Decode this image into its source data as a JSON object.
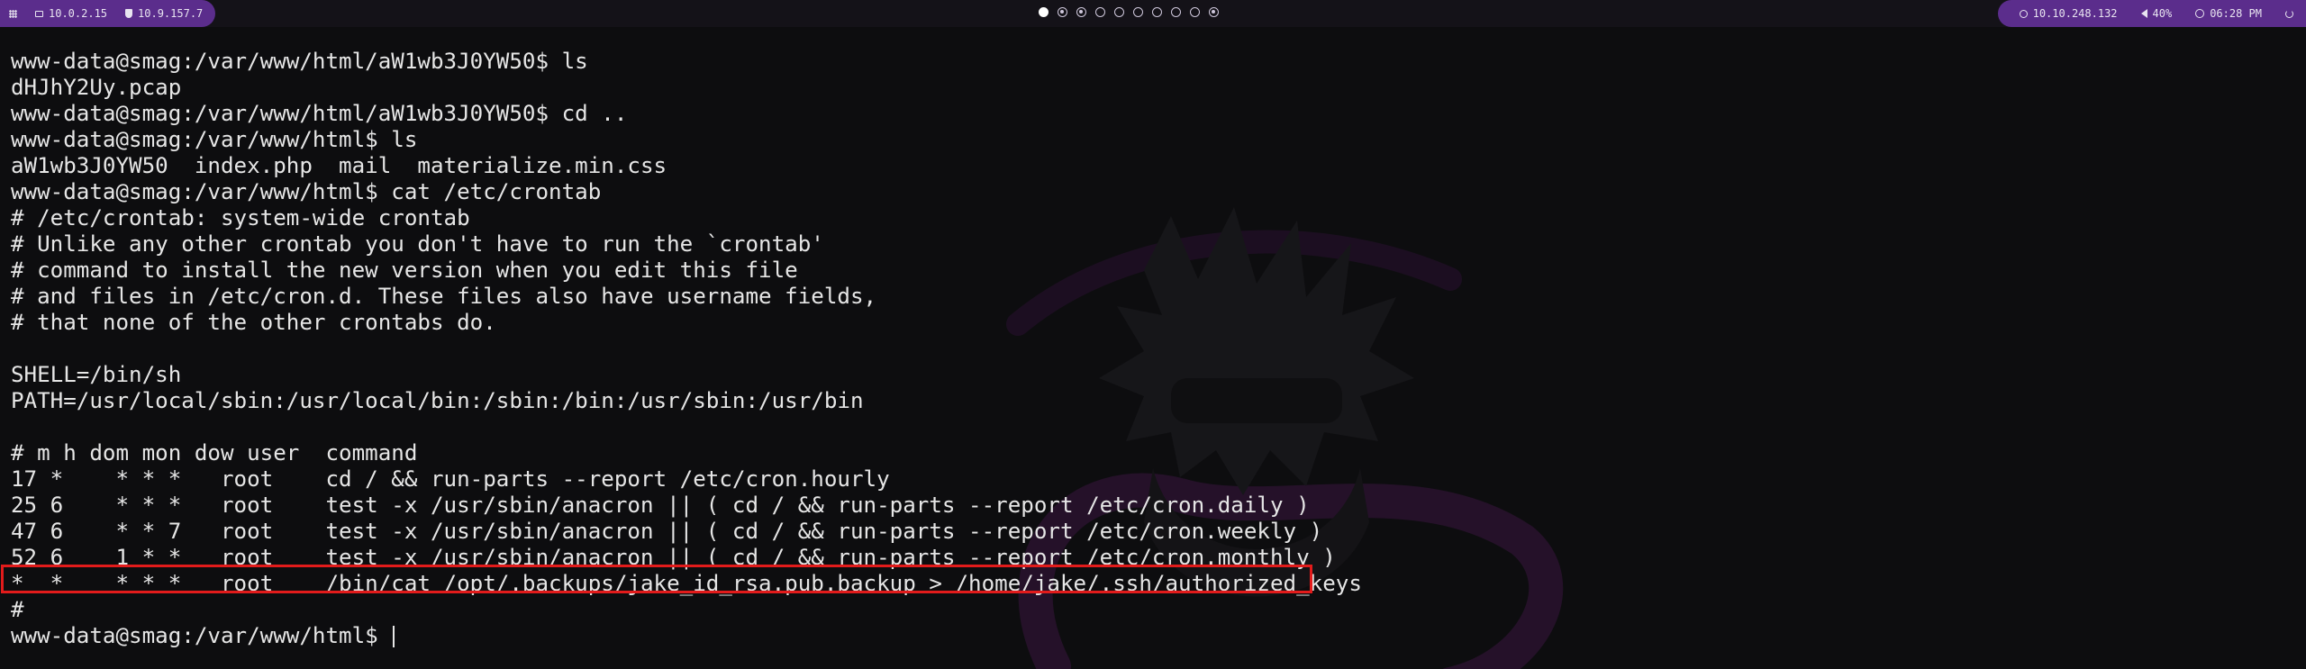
{
  "topbar": {
    "ip_local": "10.0.2.15",
    "ip_vpn": "10.9.157.7",
    "target_ip": "10.10.248.132",
    "volume": "40%",
    "time": "06:28 PM",
    "workspaces": [
      {
        "state": "active"
      },
      {
        "state": "occupied"
      },
      {
        "state": "occupied"
      },
      {
        "state": "empty"
      },
      {
        "state": "empty"
      },
      {
        "state": "empty"
      },
      {
        "state": "empty"
      },
      {
        "state": "empty"
      },
      {
        "state": "empty"
      },
      {
        "state": "occupied"
      }
    ],
    "accent_color": "#5b2d8c"
  },
  "terminal": {
    "lines": [
      "www-data@smag:/var/www/html/aW1wb3J0YW50$ ls",
      "dHJhY2Uy.pcap",
      "www-data@smag:/var/www/html/aW1wb3J0YW50$ cd ..",
      "www-data@smag:/var/www/html$ ls",
      "aW1wb3J0YW50  index.php  mail  materialize.min.css",
      "www-data@smag:/var/www/html$ cat /etc/crontab",
      "# /etc/crontab: system-wide crontab",
      "# Unlike any other crontab you don't have to run the `crontab'",
      "# command to install the new version when you edit this file",
      "# and files in /etc/cron.d. These files also have username fields,",
      "# that none of the other crontabs do.",
      "",
      "SHELL=/bin/sh",
      "PATH=/usr/local/sbin:/usr/local/bin:/sbin:/bin:/usr/sbin:/usr/bin",
      "",
      "# m h dom mon dow user  command",
      "17 *    * * *   root    cd / && run-parts --report /etc/cron.hourly",
      "25 6    * * *   root    test -x /usr/sbin/anacron || ( cd / && run-parts --report /etc/cron.daily )",
      "47 6    * * 7   root    test -x /usr/sbin/anacron || ( cd / && run-parts --report /etc/cron.weekly )",
      "52 6    1 * *   root    test -x /usr/sbin/anacron || ( cd / && run-parts --report /etc/cron.monthly )",
      "*  *    * * *   root    /bin/cat /opt/.backups/jake_id_rsa.pub.backup > /home/jake/.ssh/authorized_keys",
      "#",
      "www-data@smag:/var/www/html$ "
    ],
    "highlight_color": "#e21b1b"
  }
}
